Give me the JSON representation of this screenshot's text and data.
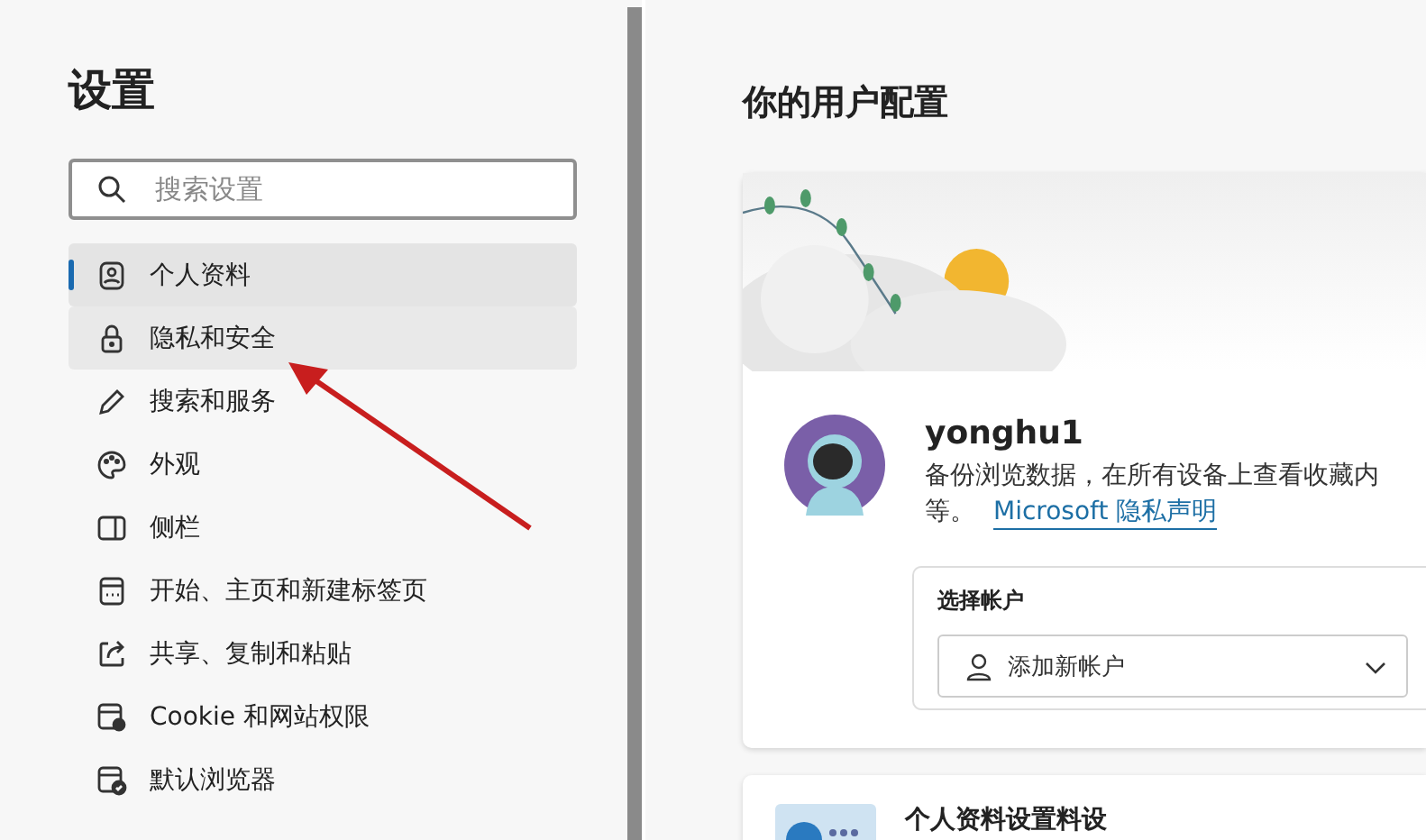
{
  "sidebar": {
    "title": "设置",
    "search": {
      "placeholder": "搜索设置"
    },
    "items": [
      {
        "label": "个人资料",
        "selected": true,
        "hovered": false
      },
      {
        "label": "隐私和安全",
        "selected": false,
        "hovered": true
      },
      {
        "label": "搜索和服务",
        "selected": false,
        "hovered": false
      },
      {
        "label": "外观",
        "selected": false,
        "hovered": false
      },
      {
        "label": "侧栏",
        "selected": false,
        "hovered": false
      },
      {
        "label": "开始、主页和新建标签页",
        "selected": false,
        "hovered": false
      },
      {
        "label": "共享、复制和粘贴",
        "selected": false,
        "hovered": false
      },
      {
        "label": "Cookie 和网站权限",
        "selected": false,
        "hovered": false
      },
      {
        "label": "默认浏览器",
        "selected": false,
        "hovered": false
      }
    ]
  },
  "main": {
    "title": "你的用户配置",
    "profile_card": {
      "name": "yonghu1",
      "description": "备份浏览数据，在所有设备上查看收藏内",
      "description_end": "等。",
      "link": "Microsoft 隐私声明",
      "account_label": "选择帐户",
      "account_dropdown": "添加新帐户"
    },
    "second_card": {
      "title": "个人资料设置料设"
    }
  }
}
